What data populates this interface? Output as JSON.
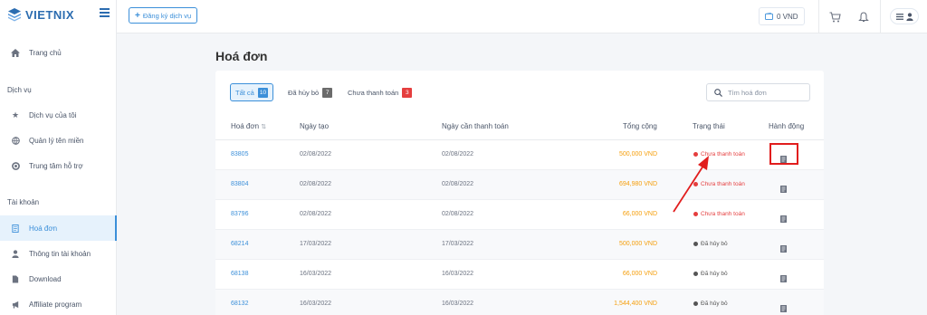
{
  "brand": {
    "name": "VIETNIX"
  },
  "sidebar": {
    "home": "Trang chủ",
    "sections": [
      {
        "title": "Dịch vụ"
      },
      {
        "title": "Tài khoản"
      }
    ],
    "service_items": [
      "Dịch vụ của tôi",
      "Quản lý tên miền",
      "Trung tâm hỗ trợ"
    ],
    "account_items": [
      "Hoá đơn",
      "Thông tin tài khoản",
      "Download",
      "Affiliate program"
    ]
  },
  "topbar": {
    "register_label": "Đăng ký dịch vụ",
    "balance": "0 VND"
  },
  "page": {
    "title": "Hoá đơn"
  },
  "tabs": [
    {
      "label": "Tất cả",
      "count": "10",
      "color": "#3b8fd9"
    },
    {
      "label": "Đã hủy bỏ",
      "count": "7",
      "color": "#6b6b6b"
    },
    {
      "label": "Chưa thanh toán",
      "count": "3",
      "color": "#e53e3e"
    }
  ],
  "search": {
    "placeholder": "Tìm hoá đơn"
  },
  "table": {
    "headers": {
      "invoice": "Hoá đơn",
      "created": "Ngày tạo",
      "due": "Ngày cần thanh toán",
      "total": "Tổng cộng",
      "status": "Trạng thái",
      "action": "Hành động"
    },
    "rows": [
      {
        "id": "83805",
        "created": "02/08/2022",
        "due": "02/08/2022",
        "total": "500,000 VND",
        "status": "Chưa thanh toán",
        "status_color": "#e53e3e"
      },
      {
        "id": "83804",
        "created": "02/08/2022",
        "due": "02/08/2022",
        "total": "694,980 VND",
        "status": "Chưa thanh toán",
        "status_color": "#e53e3e"
      },
      {
        "id": "83796",
        "created": "02/08/2022",
        "due": "02/08/2022",
        "total": "66,000 VND",
        "status": "Chưa thanh toán",
        "status_color": "#e53e3e"
      },
      {
        "id": "68214",
        "created": "17/03/2022",
        "due": "17/03/2022",
        "total": "500,000 VND",
        "status": "Đã hủy bỏ",
        "status_color": "#555555"
      },
      {
        "id": "68138",
        "created": "16/03/2022",
        "due": "16/03/2022",
        "total": "66,000 VND",
        "status": "Đã hủy bỏ",
        "status_color": "#555555"
      },
      {
        "id": "68132",
        "created": "16/03/2022",
        "due": "16/03/2022",
        "total": "1,544,400 VND",
        "status": "Đã hủy bỏ",
        "status_color": "#555555"
      }
    ]
  },
  "colors": {
    "accent": "#3b8fd9",
    "amount": "#f59e0b",
    "annotation": "#e11d1d"
  }
}
